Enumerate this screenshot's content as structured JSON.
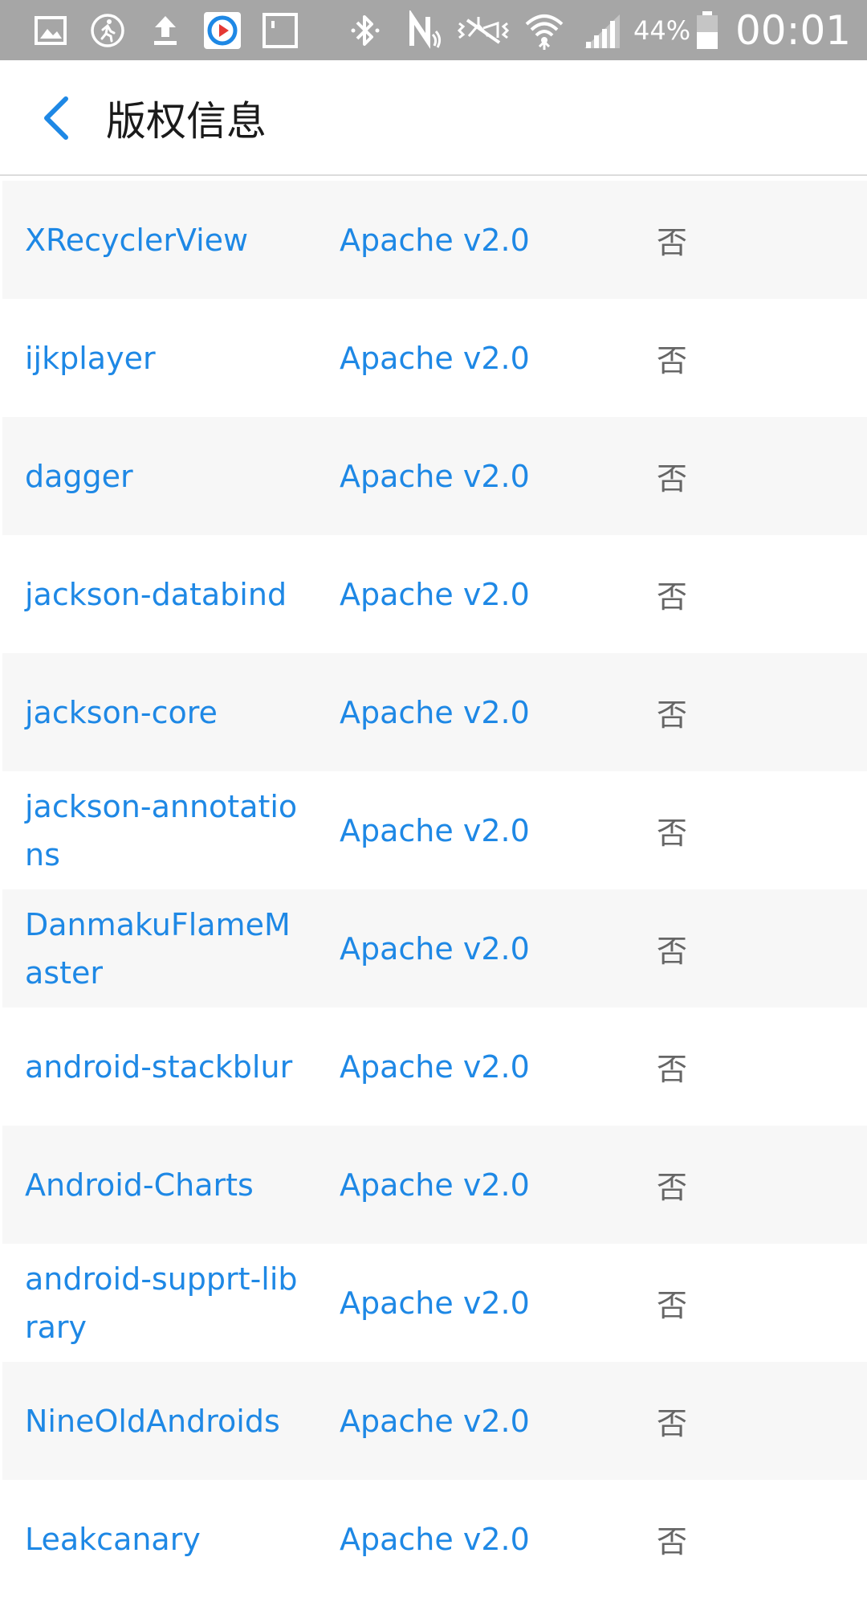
{
  "status_bar": {
    "battery_percent": "44%",
    "time": "00:01",
    "icons": [
      "gallery-icon",
      "activity-icon",
      "upload-icon",
      "app-notification-icon",
      "square-notification-icon",
      "bluetooth-icon",
      "nfc-icon",
      "vibrate-icon",
      "wifi-icon",
      "signal-icon",
      "battery-icon"
    ]
  },
  "header": {
    "title": "版权信息"
  },
  "licenses": [
    {
      "name": "XRecyclerView",
      "license": "Apache v2.0",
      "modified": "否"
    },
    {
      "name": "ijkplayer",
      "license": "Apache v2.0",
      "modified": "否"
    },
    {
      "name": "dagger",
      "license": "Apache v2.0",
      "modified": "否"
    },
    {
      "name": "jackson-databind",
      "license": "Apache v2.0",
      "modified": "否"
    },
    {
      "name": "jackson-core",
      "license": "Apache v2.0",
      "modified": "否"
    },
    {
      "name": "jackson-annotations",
      "license": "Apache v2.0",
      "modified": "否"
    },
    {
      "name": "DanmakuFlameMaster",
      "license": "Apache v2.0",
      "modified": "否"
    },
    {
      "name": "android-stackblur",
      "license": "Apache v2.0",
      "modified": "否"
    },
    {
      "name": "Android-Charts",
      "license": "Apache v2.0",
      "modified": "否"
    },
    {
      "name": "android-supprt-library",
      "license": "Apache v2.0",
      "modified": "否"
    },
    {
      "name": "NineOldAndroids",
      "license": "Apache v2.0",
      "modified": "否"
    },
    {
      "name": "Leakcanary",
      "license": "Apache v2.0",
      "modified": "否"
    }
  ],
  "colors": {
    "accent": "#1e88e5",
    "status_bar": "#a6a6a6",
    "row_alt": "#f7f7f7",
    "flag_text": "#666666"
  }
}
